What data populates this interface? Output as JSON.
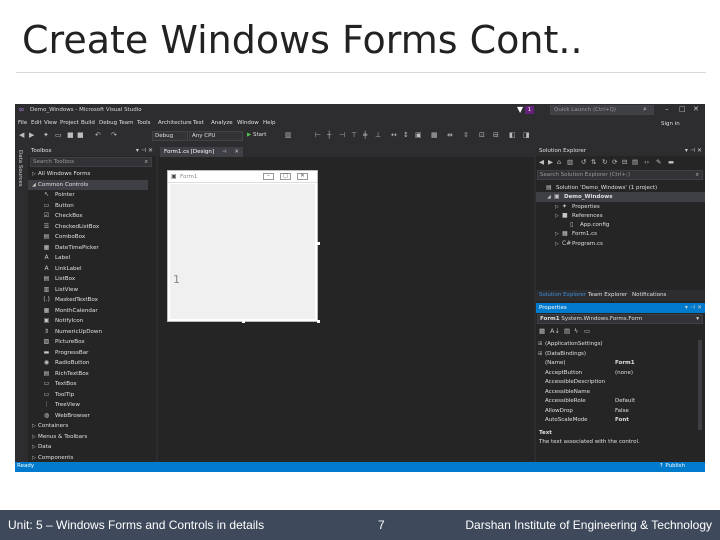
{
  "slide": {
    "title": "Create Windows Forms Cont..",
    "footer_left": "Unit: 5 – Windows Forms and Controls in details",
    "page_number": "7",
    "footer_right": "Darshan Institute of Engineering & Technology"
  },
  "vs": {
    "window_title": "Demo_Windows - Microsoft Visual Studio",
    "notification_count": "1",
    "quick_launch_placeholder": "Quick Launch (Ctrl+Q)",
    "menu": [
      "File",
      "Edit",
      "View",
      "Project",
      "Build",
      "Debug",
      "Team",
      "Tools",
      "Architecture",
      "Test",
      "Analyze",
      "Window",
      "Help"
    ],
    "sign_in": "Sign in",
    "config": "Debug",
    "platform": "Any CPU",
    "start": "Start",
    "side_strip_label": "Data Sources",
    "status_text": "Ready",
    "publish": "Publish",
    "accent_color": "#007acc"
  },
  "toolbox": {
    "title": "Toolbox",
    "search_placeholder": "Search Toolbox",
    "rows": [
      {
        "kind": "group",
        "label": "All Windows Forms",
        "open": false
      },
      {
        "kind": "group",
        "label": "Common Controls",
        "open": true,
        "selected": true
      },
      {
        "kind": "item",
        "label": "Pointer",
        "icon": "↖"
      },
      {
        "kind": "item",
        "label": "Button",
        "icon": "▭"
      },
      {
        "kind": "item",
        "label": "CheckBox",
        "icon": "☑"
      },
      {
        "kind": "item",
        "label": "CheckedListBox",
        "icon": "☰"
      },
      {
        "kind": "item",
        "label": "ComboBox",
        "icon": "▤"
      },
      {
        "kind": "item",
        "label": "DateTimePicker",
        "icon": "▦"
      },
      {
        "kind": "item",
        "label": "Label",
        "icon": "A"
      },
      {
        "kind": "item",
        "label": "LinkLabel",
        "icon": "A"
      },
      {
        "kind": "item",
        "label": "ListBox",
        "icon": "▤"
      },
      {
        "kind": "item",
        "label": "ListView",
        "icon": "▥"
      },
      {
        "kind": "item",
        "label": "MaskedTextBox",
        "icon": "(.)"
      },
      {
        "kind": "item",
        "label": "MonthCalendar",
        "icon": "▦"
      },
      {
        "kind": "item",
        "label": "NotifyIcon",
        "icon": "▣"
      },
      {
        "kind": "item",
        "label": "NumericUpDown",
        "icon": "⇕"
      },
      {
        "kind": "item",
        "label": "PictureBox",
        "icon": "▨"
      },
      {
        "kind": "item",
        "label": "ProgressBar",
        "icon": "▬"
      },
      {
        "kind": "item",
        "label": "RadioButton",
        "icon": "◉"
      },
      {
        "kind": "item",
        "label": "RichTextBox",
        "icon": "▤"
      },
      {
        "kind": "item",
        "label": "TextBox",
        "icon": "▭"
      },
      {
        "kind": "item",
        "label": "ToolTip",
        "icon": "▭"
      },
      {
        "kind": "item",
        "label": "TreeView",
        "icon": "⋮"
      },
      {
        "kind": "item",
        "label": "WebBrowser",
        "icon": "◍"
      },
      {
        "kind": "group",
        "label": "Containers",
        "open": false
      },
      {
        "kind": "group",
        "label": "Menus & Toolbars",
        "open": false
      },
      {
        "kind": "group",
        "label": "Data",
        "open": false
      },
      {
        "kind": "group",
        "label": "Components",
        "open": false
      }
    ]
  },
  "designer": {
    "tab_label": "Form1.cs [Design]",
    "form_caption": "Form1",
    "annotation": "1"
  },
  "solution": {
    "title": "Solution Explorer",
    "search_placeholder": "Search Solution Explorer (Ctrl+;)",
    "tree": [
      {
        "label": "Solution 'Demo_Windows' (1 project)",
        "icon": "▤",
        "tri": "",
        "indent": 0
      },
      {
        "label": "Demo_Windows",
        "icon": "▣",
        "tri": "◢",
        "indent": 1,
        "selected": true
      },
      {
        "label": "Properties",
        "icon": "✦",
        "tri": "▷",
        "indent": 2
      },
      {
        "label": "References",
        "icon": "■",
        "tri": "▷",
        "indent": 2
      },
      {
        "label": "App.config",
        "icon": "▯",
        "tri": "",
        "indent": 3
      },
      {
        "label": "Form1.cs",
        "icon": "▦",
        "tri": "▷",
        "indent": 2
      },
      {
        "label": "Program.cs",
        "icon": "C#",
        "tri": "▷",
        "indent": 2
      }
    ],
    "tabs": [
      "Solution Explorer",
      "Team Explorer",
      "Notifications"
    ]
  },
  "properties": {
    "title": "Properties",
    "object_name": "Form1",
    "object_type": "System.Windows.Forms.Form",
    "rows": [
      {
        "kind": "cat",
        "name": "(ApplicationSettings)",
        "value": ""
      },
      {
        "kind": "cat",
        "name": "(DataBindings)",
        "value": ""
      },
      {
        "kind": "prop",
        "name": "(Name)",
        "value": "Form1",
        "bold": true
      },
      {
        "kind": "prop",
        "name": "AcceptButton",
        "value": "(none)"
      },
      {
        "kind": "prop",
        "name": "AccessibleDescription",
        "value": ""
      },
      {
        "kind": "prop",
        "name": "AccessibleName",
        "value": ""
      },
      {
        "kind": "prop",
        "name": "AccessibleRole",
        "value": "Default"
      },
      {
        "kind": "prop",
        "name": "AllowDrop",
        "value": "False"
      },
      {
        "kind": "prop",
        "name": "AutoScaleMode",
        "value": "Font",
        "bold": true
      }
    ],
    "description_title": "Text",
    "description_text": "The text associated with the control."
  }
}
